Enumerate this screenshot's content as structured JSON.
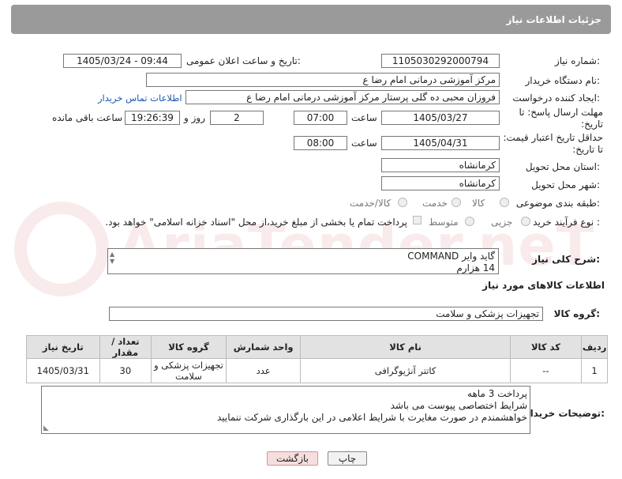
{
  "panel": {
    "title": "جزئیات اطلاعات نیاز"
  },
  "watermark": {
    "text": "AriaTender.neT"
  },
  "form": {
    "need_number_label": "شماره نیاز:",
    "need_number": "1105030292000794",
    "announce_label": "تاریخ و ساعت اعلان عمومی:",
    "announce_value": "1405/03/24 - 09:44",
    "buyer_org_label": "نام دستگاه خریدار:",
    "buyer_org": "مرکز آموزشی  درمانی امام رضا  ع",
    "creator_label": "ایجاد کننده درخواست:",
    "creator": "فروزان محبی ده گلی پرستار مرکز آموزشی  درمانی امام رضا  ع",
    "contact_link": "اطلاعات تماس خریدار",
    "deadline_label": "مهلت ارسال پاسخ: تا تاریخ:",
    "deadline_date": "1405/03/27",
    "time_label": "ساعت",
    "deadline_time": "07:00",
    "days_value": "2",
    "days_label": "روز و",
    "remaining_time": "19:26:39",
    "remaining_label": "ساعت باقی مانده",
    "min_price_label": "حداقل تاریخ اعتبار قیمت: تا تاریخ:",
    "price_date": "1405/04/31",
    "price_time": "08:00",
    "province_label": "استان محل تحویل:",
    "province": "کرمانشاه",
    "city_label": "شهر محل تحویل:",
    "city": "کرمانشاه",
    "category_label": "طبقه بندی موضوعی:",
    "category_options": [
      "کالا",
      "خدمت",
      "کالا/خدمت"
    ],
    "process_label": "نوع فرآیند خرید :",
    "process_options": [
      "جزیی",
      "متوسط"
    ],
    "payment_note": "پرداخت تمام یا بخشی از مبلغ خرید،از محل \"اسناد خزانه اسلامی\" خواهد بود.",
    "general_desc_label": "شرح کلی نیاز:",
    "general_desc_line1": "گاید وایر COMMAND",
    "general_desc_line2": "14 هزارم"
  },
  "goods": {
    "section_title": "اطلاعات کالاهای مورد نیاز",
    "group_label": "گروه کالا:",
    "group_value": "تجهیزات پزشکی و سلامت",
    "columns": [
      "ردیف",
      "کد کالا",
      "نام کالا",
      "واحد شمارش",
      "گروه کالا",
      "تعداد / مقدار",
      "تاریخ نیاز"
    ],
    "rows": [
      {
        "row": "1",
        "code": "--",
        "name": "کاتتر آنژیوگرافی",
        "unit": "عدد",
        "group": "تجهیزات پزشکی و سلامت",
        "qty": "30",
        "date": "1405/03/31"
      }
    ]
  },
  "buyer_notes": {
    "label": "توضیحات خریدار:",
    "line1": "پرداخت 3 ماهه",
    "line2": "شرایط اختصاصی پیوست می باشد",
    "line3": "خواهشمندم  در صورت مغایرت با شرایط اعلامی در این بارگذاری شرکت ننمایید"
  },
  "buttons": {
    "print": "چاپ",
    "back": "بازگشت"
  }
}
